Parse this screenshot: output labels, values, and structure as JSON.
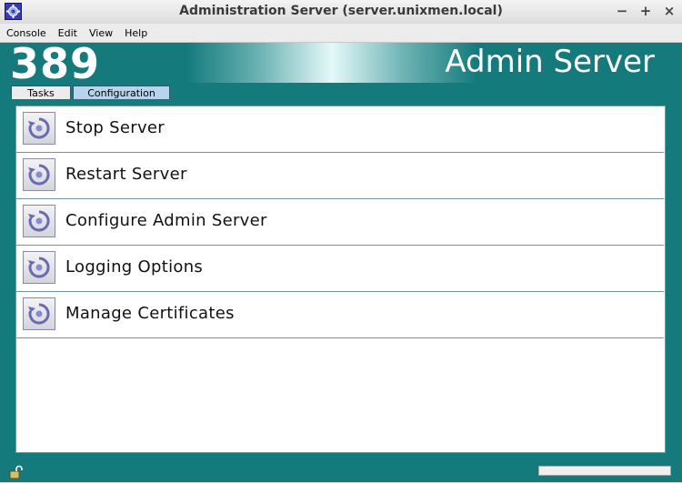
{
  "window": {
    "title": "Administration Server (server.unixmen.local)",
    "buttons": {
      "minimize": "−",
      "maximize": "+",
      "close": "×"
    }
  },
  "menu": {
    "items": [
      "Console",
      "Edit",
      "View",
      "Help"
    ]
  },
  "banner": {
    "number": "389",
    "product": "Admin Server"
  },
  "tabs": [
    {
      "label": "Tasks",
      "selected": false
    },
    {
      "label": "Configuration",
      "selected": true
    }
  ],
  "tasks": [
    {
      "label": "Stop Server",
      "icon": "task-icon"
    },
    {
      "label": "Restart Server",
      "icon": "task-icon"
    },
    {
      "label": "Configure Admin Server",
      "icon": "task-icon"
    },
    {
      "label": "Logging Options",
      "icon": "task-icon"
    },
    {
      "label": "Manage Certificates",
      "icon": "task-icon"
    }
  ],
  "status": {
    "icon": "lock-icon"
  },
  "colors": {
    "frame": "#147a7c",
    "tab_selected": "#b8d4ec"
  }
}
